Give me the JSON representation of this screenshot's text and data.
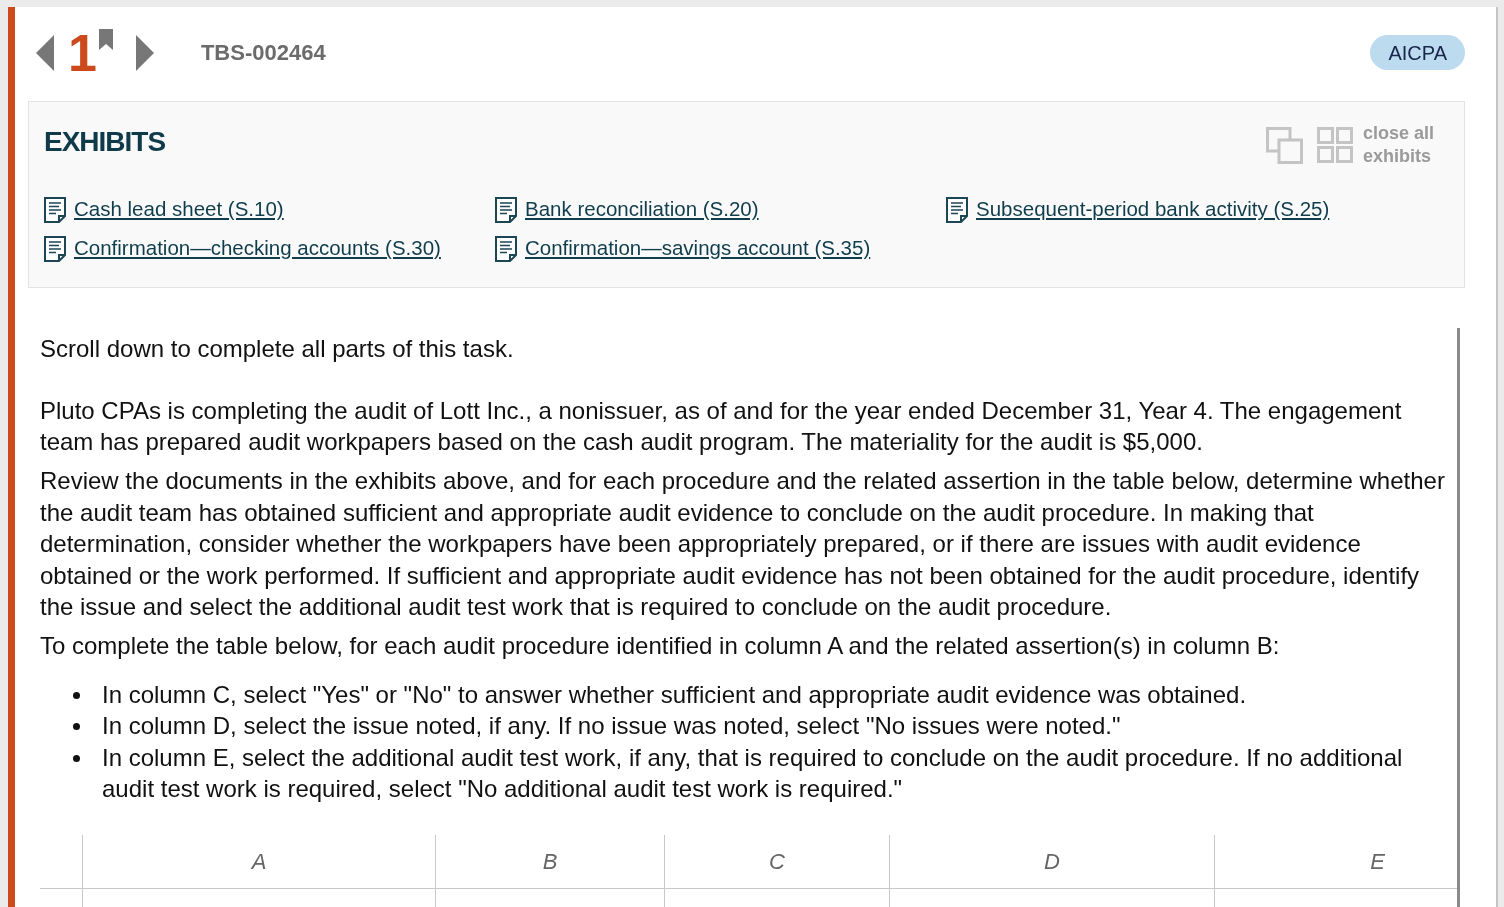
{
  "header": {
    "question_number": "1",
    "task_id": "TBS-002464",
    "badge": "AICPA"
  },
  "exhibits": {
    "title": "EXHIBITS",
    "toolbar": {
      "disabled": true,
      "close_all": "close all exhibits"
    },
    "links": [
      "Cash lead sheet (S.10)",
      "Bank reconciliation (S.20)",
      "Subsequent-period bank activity (S.25)",
      "Confirmation—checking accounts (S.30)",
      "Confirmation—savings account (S.35)"
    ]
  },
  "instructions": {
    "paragraphs": [
      "Scroll down to complete all parts of this task.",
      "Pluto CPAs is completing the audit of Lott Inc., a nonissuer, as of and for the year ended December 31, Year 4. The engagement team has prepared audit workpapers based on the cash audit program. The materiality for the audit is $5,000.",
      "Review the documents in the exhibits above, and for each procedure and the related assertion in the table below, determine whether the audit team has obtained sufficient and appropriate audit evidence to conclude on the audit procedure. In making that determination, consider whether the workpapers have been appropriately prepared, or if there are issues with audit evidence obtained or the work performed. If sufficient and appropriate audit evidence has not been obtained for the audit procedure, identify the issue and select the additional audit test work that is required to conclude on the audit procedure.",
      "To complete the table below, for each audit procedure identified in column A and the related assertion(s) in column B:"
    ],
    "bullets": [
      "In column C, select \"Yes\" or \"No\" to answer whether sufficient and appropriate audit evidence was obtained.",
      "In column D, select the issue noted, if any. If no issue was noted, select \"No issues were noted.\"",
      "In column E, select the additional audit test work, if any, that is required to conclude on the audit procedure. If no additional audit test work is required, select \"No additional audit test work is required.\""
    ]
  },
  "table": {
    "columns": [
      "A",
      "B",
      "C",
      "D",
      "E"
    ]
  }
}
